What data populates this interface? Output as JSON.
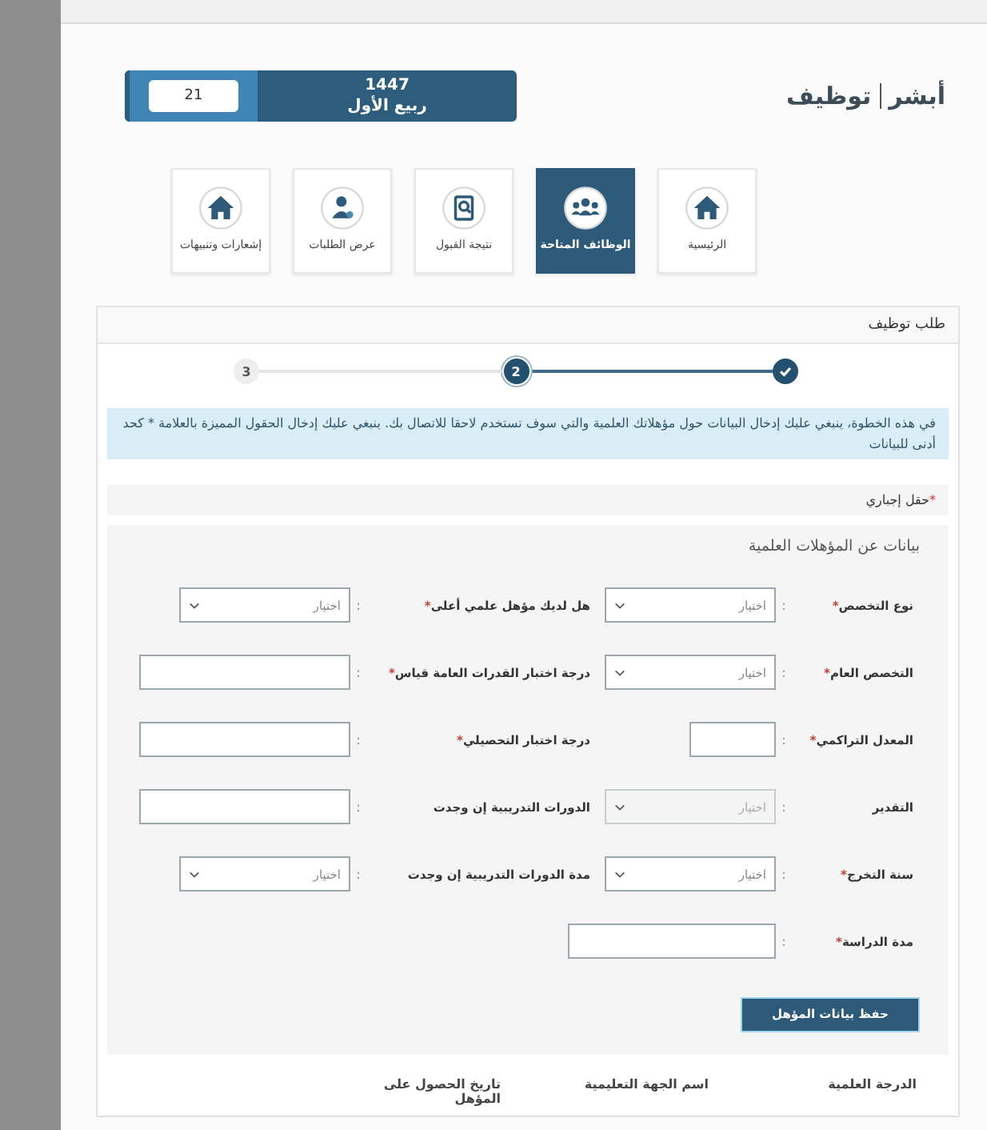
{
  "header": {
    "logo": {
      "part1": "أبشر",
      "part2": "توظيف"
    },
    "date": {
      "day": "21",
      "year": "1447",
      "month": "ربيع الأول"
    }
  },
  "nav": [
    {
      "label": "الرئيسية",
      "selected": false
    },
    {
      "label": "الوظائف المتاحة",
      "selected": true
    },
    {
      "label": "نتيجة القبول",
      "selected": false
    },
    {
      "label": "عرض الطلبات",
      "selected": false
    },
    {
      "label": "إشعارات وتنبيهات",
      "selected": false
    }
  ],
  "panel": {
    "title": "طلب توظيف",
    "steps": [
      {
        "done": true,
        "selected": false
      },
      {
        "label": "2",
        "done": false,
        "selected": true
      },
      {
        "label": "3",
        "done": false,
        "selected": false
      }
    ],
    "info": "في هذه الخطوة، ينبغي عليك إدخال البيانات حول مؤهلاتك العلمية والتي سوف تستخدم لاحقا للاتصال بك. ينبغي عليك إدخال الحقول المميزة بالعلامة * كحد أدنى للبيانات",
    "required_note": {
      "mark": "*",
      "text": "حقل إجباري"
    },
    "section_title": "بيانات عن المؤهلات العلمية",
    "fields": [
      {
        "label": "نوع التخصص",
        "mark": "*",
        "separator": ":",
        "kind": "select",
        "placeholder": "اختيار",
        "disabled": false
      },
      {
        "label": "هل لديك مؤهل علمي أعلى",
        "mark": "*",
        "separator": ":",
        "kind": "select",
        "placeholder": "اختيار",
        "disabled": false
      },
      {
        "label": "التخصص العام",
        "mark": "*",
        "separator": ":",
        "kind": "select",
        "placeholder": "اختيار",
        "disabled": false
      },
      {
        "label": "درجة اختبار القدرات العامة قياس",
        "mark": "*",
        "separator": ":",
        "kind": "input",
        "disabled": false
      },
      {
        "label": "المعدل التراكمي",
        "mark": "*",
        "separator": ":",
        "kind": "short",
        "disabled": false
      },
      {
        "label": "درجة اختبار التحصيلي",
        "mark": "*",
        "separator": ":",
        "kind": "input",
        "disabled": false
      },
      {
        "label": "التقدير",
        "separator": ":",
        "kind": "select",
        "placeholder": "اختيار",
        "disabled": true
      },
      {
        "label": "الدورات التدريبية إن وجدت",
        "separator": ":",
        "kind": "input",
        "disabled": false
      },
      {
        "label": "سنة التخرج",
        "mark": "*",
        "separator": ":",
        "kind": "select",
        "placeholder": "اختيار",
        "disabled": false
      },
      {
        "label": "مدة الدورات التدريبية إن وجدت",
        "separator": ":",
        "kind": "select",
        "placeholder": "اختيار",
        "disabled": false
      },
      {
        "label": "مدة الدراسة",
        "mark": "*",
        "separator": ":",
        "kind": "long",
        "disabled": false
      }
    ],
    "save_button": "حفظ بيانات المؤهل",
    "table": {
      "columns": [
        "الدرجة العلمية",
        "اسم الجهة التعليمية",
        "تاريخ الحصول على المؤهل"
      ]
    }
  }
}
